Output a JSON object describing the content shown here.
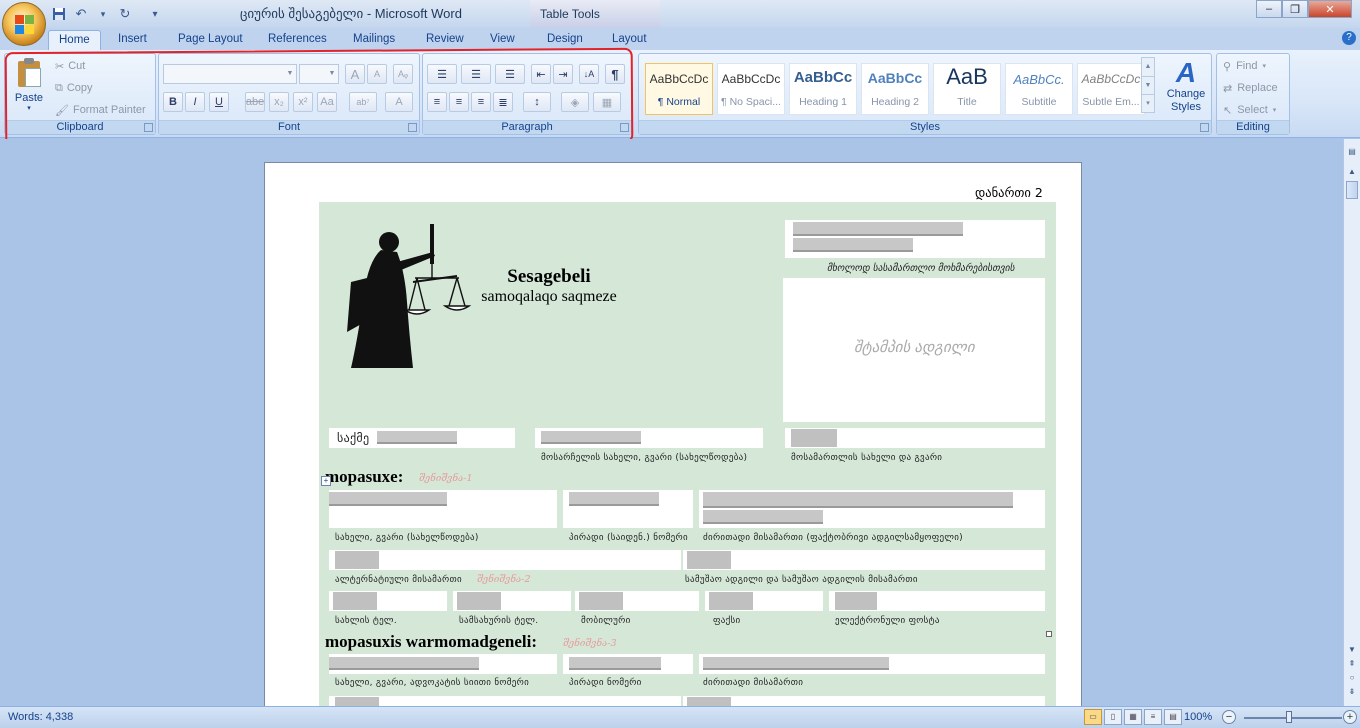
{
  "window": {
    "title": "ციურის შესაგებელი - Microsoft Word",
    "context_tab_title": "Table Tools",
    "controls": {
      "minimize": "–",
      "restore": "❐",
      "close": "✕"
    }
  },
  "qat": {
    "save_icon": "💾",
    "undo_icon": "↶",
    "redo_icon": "↻",
    "more_icon": "▾"
  },
  "tabs": [
    "Home",
    "Insert",
    "Page Layout",
    "References",
    "Mailings",
    "Review",
    "View",
    "Design",
    "Layout"
  ],
  "ribbon": {
    "clipboard": {
      "label": "Clipboard",
      "paste": "Paste",
      "cut": "Cut",
      "copy": "Copy",
      "format_painter": "Format Painter"
    },
    "font": {
      "label": "Font",
      "font_name": "",
      "font_size": "",
      "grow": "A",
      "shrink": "A",
      "clear": "Aᵩ",
      "bold": "B",
      "italic": "I",
      "underline": "U",
      "strike": "abe",
      "sub": "x₂",
      "sup": "x²",
      "case": "Aa",
      "highlight": "ab⁷",
      "color": "A"
    },
    "paragraph": {
      "label": "Paragraph",
      "show_hide": "¶",
      "sort": "↓A"
    },
    "styles": {
      "label": "Styles",
      "items": [
        {
          "preview": "AaBbCcDc",
          "name": "¶ Normal"
        },
        {
          "preview": "AaBbCcDc",
          "name": "¶ No Spaci..."
        },
        {
          "preview": "AaBbCc",
          "name": "Heading 1"
        },
        {
          "preview": "AaBbCc",
          "name": "Heading 2"
        },
        {
          "preview": "AaB",
          "name": "Title"
        },
        {
          "preview": "AaBbCc.",
          "name": "Subtitle"
        },
        {
          "preview": "AaBbCcDc",
          "name": "Subtle Em..."
        }
      ],
      "change_styles": "Change Styles"
    },
    "editing": {
      "label": "Editing",
      "find": "Find",
      "replace": "Replace",
      "select": "Select"
    }
  },
  "document": {
    "annex": "დანართი 2",
    "title": "Sesagebeli",
    "subtitle": "samoqalaqo saqmeze",
    "court_only": "მხოლოდ სასამართლო მოხმარებისთვის",
    "stamp_place": "შტამპის ადგილი",
    "case_prefix": "საქმე",
    "plaintiff_caption": "მოსარჩელის სახელი, გვარი (სახელწოდება)",
    "judge_caption": "მოსამართლის სახელი და გვარი",
    "section1": "mopasuxe:",
    "hint1": "შენიშვნა-1",
    "name_caption": "სახელი, გვარი (სახელწოდება)",
    "id_caption": "პირადი (საიდენ.) ნომერი",
    "address_caption": "ძირითადი მისამართი (ფაქტობრივი ადგილსამყოფელი)",
    "alt_address_caption": "ალტერნატიული მისამართი",
    "hint2": "შენიშვნა-2",
    "work_caption": "სამუშაო ადგილი და სამუშაო ადგილის მისამართი",
    "home_phone": "სახლის ტელ.",
    "work_phone": "სამსახურის ტელ.",
    "mobile": "მობილური",
    "fax": "ფაქსი",
    "email": "ელექტრონული ფოსტა",
    "section2": "mopasuxis warmomadgeneli:",
    "hint3": "შენიშვნა-3",
    "rep_name_caption": "სახელი, გვარი, ადვოკატის სიითი ნომერი",
    "rep_id_caption": "პირადი ნომერი",
    "rep_address_caption": "ძირითადი მისამართი"
  },
  "statusbar": {
    "words": "Words: 4,338",
    "zoom": "100%"
  },
  "colors": {
    "form_bg": "#d5e8d8",
    "highlight_red": "#e3222a",
    "ribbon_text": "#15428b"
  }
}
